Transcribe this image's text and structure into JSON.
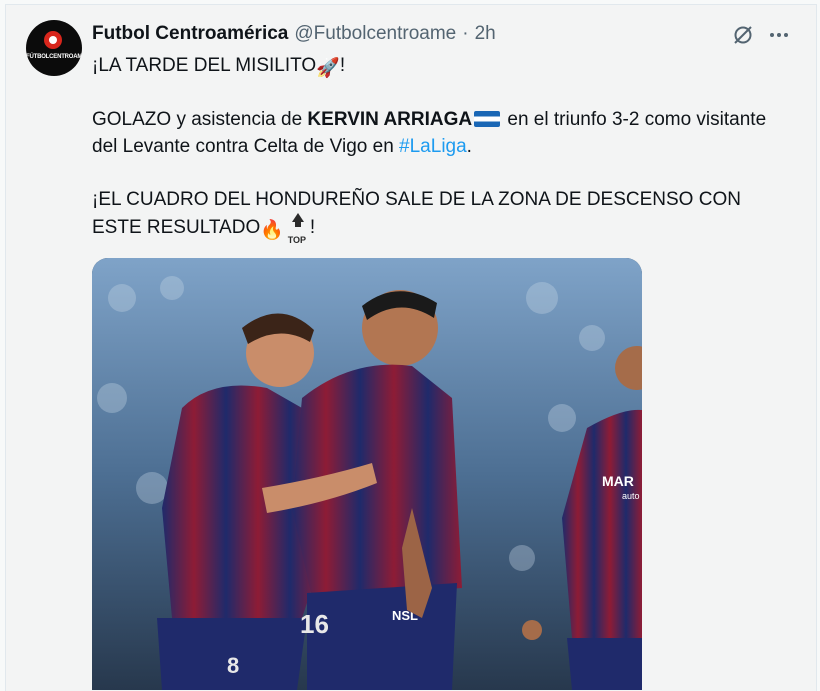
{
  "tweet": {
    "author_name": "Futbol Centroamérica",
    "author_handle": "@Futbolcentroame",
    "separator": "·",
    "time": "2h",
    "avatar_text": "FÚTBOLCENTROAMÉRICA",
    "line1": "¡LA TARDE DEL MISILITO",
    "line1_emoji": "🚀",
    "line1_end": "!",
    "line2_a": "GOLAZO y asistencia de ",
    "line2_bold": "KERVIN ARRIAGA",
    "line2_b": " en el triunfo 3-2 como visitante del Levante contra Celta de Vigo en ",
    "hashtag": "#LaLiga",
    "line2_end": ".",
    "line3": "¡EL CUADRO DEL HONDUREÑO SALE DE LA ZONA DE DESCENSO CON ESTE RESULTADO",
    "fire_emoji": "🔥",
    "top_label": "TOP",
    "line3_end": "!",
    "media": {
      "shirt_numbers": [
        "8",
        "16"
      ],
      "sponsor": "MAR",
      "sponsor_sub": "auto",
      "shorts_text": "NSL"
    }
  },
  "icons": {
    "grok": "grok-icon",
    "more": "more-icon",
    "flag": "honduras-flag-icon",
    "top": "top-arrow-icon"
  },
  "colors": {
    "hashtag": "#1d9bf0",
    "secondary_text": "#536471",
    "primary_text": "#0f1419",
    "background": "#f3f4f4"
  }
}
